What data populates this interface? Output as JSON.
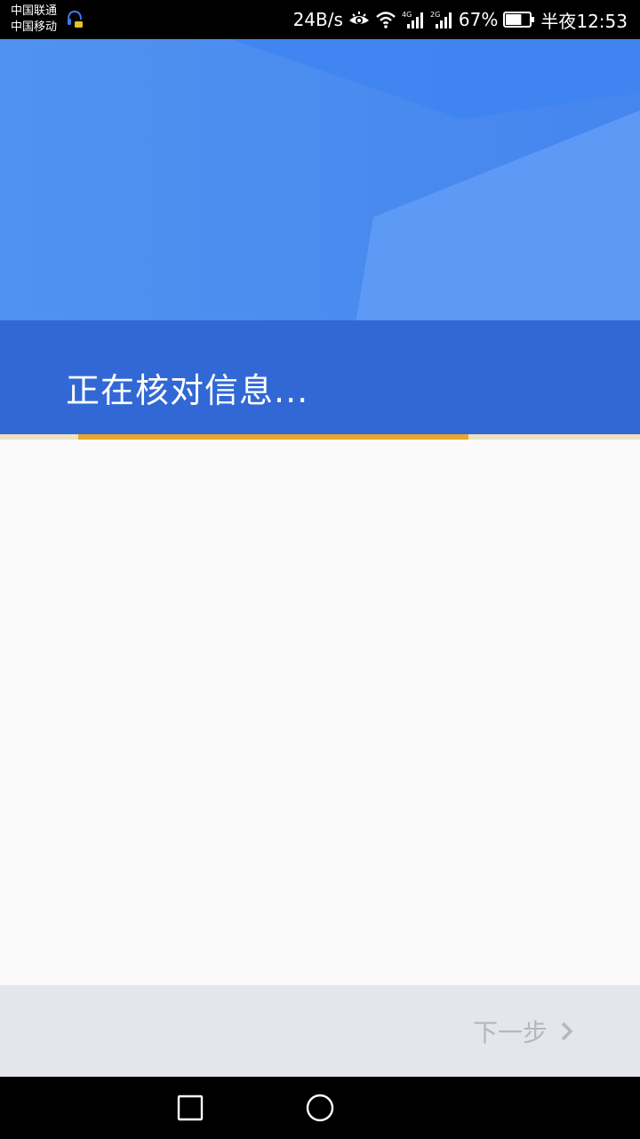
{
  "status_bar": {
    "carrier_1": "中国联通",
    "carrier_2": "中国移动",
    "net_speed": "24B/s",
    "signal_1_type": "4G",
    "signal_2_type": "2G",
    "battery": "67%",
    "battery_level": 0.67,
    "time": "半夜12:53"
  },
  "header": {
    "title": "正在核对信息..."
  },
  "progress": {
    "value_fraction": 0.61
  },
  "action_bar": {
    "next_label": "下一步"
  },
  "colors": {
    "header_blue": "#4a88ee",
    "band_blue": "#3168d6",
    "progress_accent": "#e6a72a",
    "disabled_text": "#b4b7bb"
  }
}
